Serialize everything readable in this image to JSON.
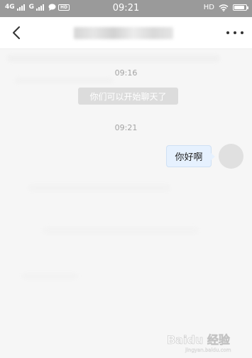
{
  "status_bar": {
    "network_1": "4G",
    "network_2": "G",
    "time": "09:21",
    "hd_label": "HD",
    "battery_level": 0.85
  },
  "nav": {
    "back_icon": "chevron-left-icon",
    "more_icon": "more-dots-icon"
  },
  "chat": {
    "timestamp_1": "09:16",
    "system_message": "你们可以开始聊天了",
    "timestamp_2": "09:21",
    "messages": [
      {
        "text": "你好啊",
        "sender": "self"
      }
    ]
  },
  "watermark": {
    "brand": "Baidu 经验",
    "url": "jingyan.baidu.com"
  },
  "colors": {
    "status_bar": "#9a9a9a",
    "chat_background": "#f6f6f6",
    "bubble_self": "#e6f1fe",
    "system_pill": "#dcdcdc",
    "timestamp_text": "#a3a3a3"
  }
}
